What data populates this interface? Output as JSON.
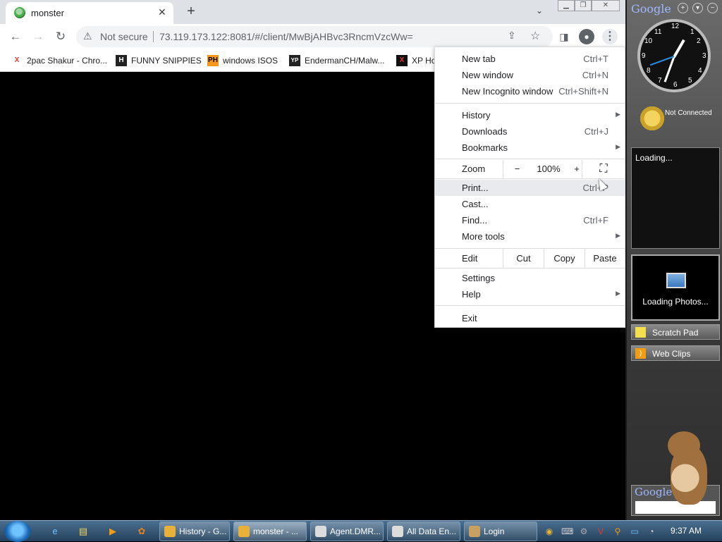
{
  "browser": {
    "tab": {
      "title": "monster"
    },
    "omnibox": {
      "security": "Not secure",
      "url": "73.119.173.122:8081/#/client/MwBjAHBvc3RncmVzcWw="
    },
    "bookmarks": [
      {
        "label": "2pac Shakur - Chro...",
        "icon": "X"
      },
      {
        "label": "FUNNY SNIPPIES",
        "icon": "H"
      },
      {
        "label": "windows ISOS",
        "icon": "PH"
      },
      {
        "label": "EndermanCH/Malw...",
        "icon": "YP"
      },
      {
        "label": "XP Ho",
        "icon": "X"
      }
    ]
  },
  "menu": {
    "new_tab": {
      "label": "New tab",
      "shortcut": "Ctrl+T"
    },
    "new_window": {
      "label": "New window",
      "shortcut": "Ctrl+N"
    },
    "incognito": {
      "label": "New Incognito window",
      "shortcut": "Ctrl+Shift+N"
    },
    "history": {
      "label": "History"
    },
    "downloads": {
      "label": "Downloads",
      "shortcut": "Ctrl+J"
    },
    "bookmarks": {
      "label": "Bookmarks"
    },
    "zoom": {
      "label": "Zoom",
      "minus": "−",
      "value": "100%",
      "plus": "+"
    },
    "print": {
      "label": "Print...",
      "shortcut": "Ctrl+P"
    },
    "cast": {
      "label": "Cast..."
    },
    "find": {
      "label": "Find...",
      "shortcut": "Ctrl+F"
    },
    "more_tools": {
      "label": "More tools"
    },
    "edit": {
      "label": "Edit",
      "cut": "Cut",
      "copy": "Copy",
      "paste": "Paste"
    },
    "settings": {
      "label": "Settings"
    },
    "help": {
      "label": "Help"
    },
    "exit": {
      "label": "Exit"
    }
  },
  "sidebar": {
    "logo": "Google",
    "clock_numbers": [
      "12",
      "1",
      "2",
      "3",
      "4",
      "5",
      "6",
      "7",
      "8",
      "9",
      "10",
      "11"
    ],
    "weather_status": "Not Connected",
    "loading_text": "Loading...",
    "photos_text": "Loading Photos...",
    "scratch_pad": "Scratch Pad",
    "web_clips": "Web Clips",
    "search_logo": "Google"
  },
  "taskbar": {
    "tasks": [
      {
        "label": "History - G...",
        "color": "#e8b23a"
      },
      {
        "label": "monster - ...",
        "color": "#e8b23a"
      },
      {
        "label": "Agent.DMR...",
        "color": "#dcdcdc"
      },
      {
        "label": "All Data En...",
        "color": "#dcdcdc"
      },
      {
        "label": "Login",
        "color": "#c8a060"
      }
    ],
    "time": "9:37 AM"
  }
}
